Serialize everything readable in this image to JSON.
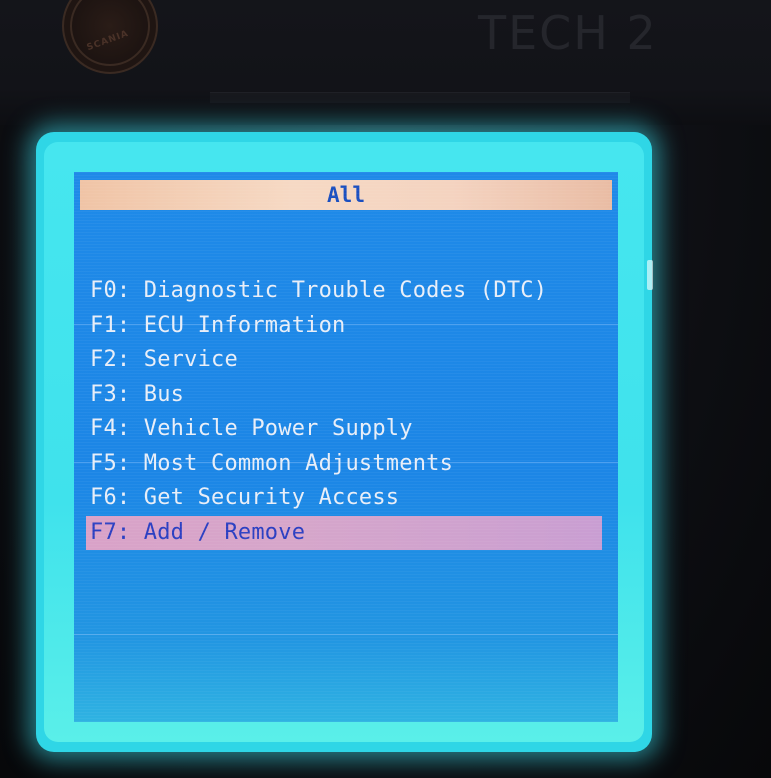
{
  "device": {
    "brand_text": "TECH 2",
    "logo_text": "SCANIA"
  },
  "screen": {
    "title": "All",
    "menu": [
      {
        "key": "F0:",
        "label": "Diagnostic Trouble Codes (DTC)",
        "selected": false
      },
      {
        "key": "F1:",
        "label": "ECU Information",
        "selected": false
      },
      {
        "key": "F2:",
        "label": "Service",
        "selected": false
      },
      {
        "key": "F3:",
        "label": "Bus",
        "selected": false
      },
      {
        "key": "F4:",
        "label": "Vehicle Power Supply",
        "selected": false
      },
      {
        "key": "F5:",
        "label": "Most Common Adjustments",
        "selected": false
      },
      {
        "key": "F6:",
        "label": "Get Security Access",
        "selected": false
      },
      {
        "key": "F7:",
        "label": "Add / Remove",
        "selected": true
      }
    ]
  },
  "colors": {
    "screen_background": "#1f8ae8",
    "title_bar": "#f4d3c0",
    "selection_highlight": "#d6a6ca",
    "menu_text": "#e8eef8",
    "screen_glow": "#2fd6e6"
  }
}
